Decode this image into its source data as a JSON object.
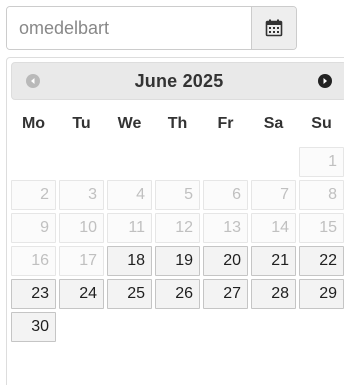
{
  "input": {
    "placeholder": "omedelbart",
    "value": ""
  },
  "icons": {
    "calendar": "calendar-icon",
    "prev": "prev-month-icon",
    "next": "next-month-icon"
  },
  "datepicker": {
    "month_label": "June",
    "year_label": "2025",
    "weekdays": [
      "Mo",
      "Tu",
      "We",
      "Th",
      "Fr",
      "Sa",
      "Su"
    ],
    "weeks": [
      [
        null,
        null,
        null,
        null,
        null,
        null,
        {
          "d": "1",
          "enabled": false
        }
      ],
      [
        {
          "d": "2",
          "enabled": false
        },
        {
          "d": "3",
          "enabled": false
        },
        {
          "d": "4",
          "enabled": false
        },
        {
          "d": "5",
          "enabled": false
        },
        {
          "d": "6",
          "enabled": false
        },
        {
          "d": "7",
          "enabled": false
        },
        {
          "d": "8",
          "enabled": false
        }
      ],
      [
        {
          "d": "9",
          "enabled": false
        },
        {
          "d": "10",
          "enabled": false
        },
        {
          "d": "11",
          "enabled": false
        },
        {
          "d": "12",
          "enabled": false
        },
        {
          "d": "13",
          "enabled": false
        },
        {
          "d": "14",
          "enabled": false
        },
        {
          "d": "15",
          "enabled": false
        }
      ],
      [
        {
          "d": "16",
          "enabled": false
        },
        {
          "d": "17",
          "enabled": false
        },
        {
          "d": "18",
          "enabled": true
        },
        {
          "d": "19",
          "enabled": true
        },
        {
          "d": "20",
          "enabled": true
        },
        {
          "d": "21",
          "enabled": true
        },
        {
          "d": "22",
          "enabled": true
        }
      ],
      [
        {
          "d": "23",
          "enabled": true
        },
        {
          "d": "24",
          "enabled": true
        },
        {
          "d": "25",
          "enabled": true
        },
        {
          "d": "26",
          "enabled": true
        },
        {
          "d": "27",
          "enabled": true
        },
        {
          "d": "28",
          "enabled": true
        },
        {
          "d": "29",
          "enabled": true
        }
      ],
      [
        {
          "d": "30",
          "enabled": true
        },
        null,
        null,
        null,
        null,
        null,
        null
      ]
    ]
  },
  "colors": {
    "header_bg": "#e9e9e9",
    "active_day_bg": "#f3f3f3",
    "disabled_day_text": "#c0c0c0",
    "next_icon": "#222222",
    "prev_icon": "#b9b9b9"
  }
}
